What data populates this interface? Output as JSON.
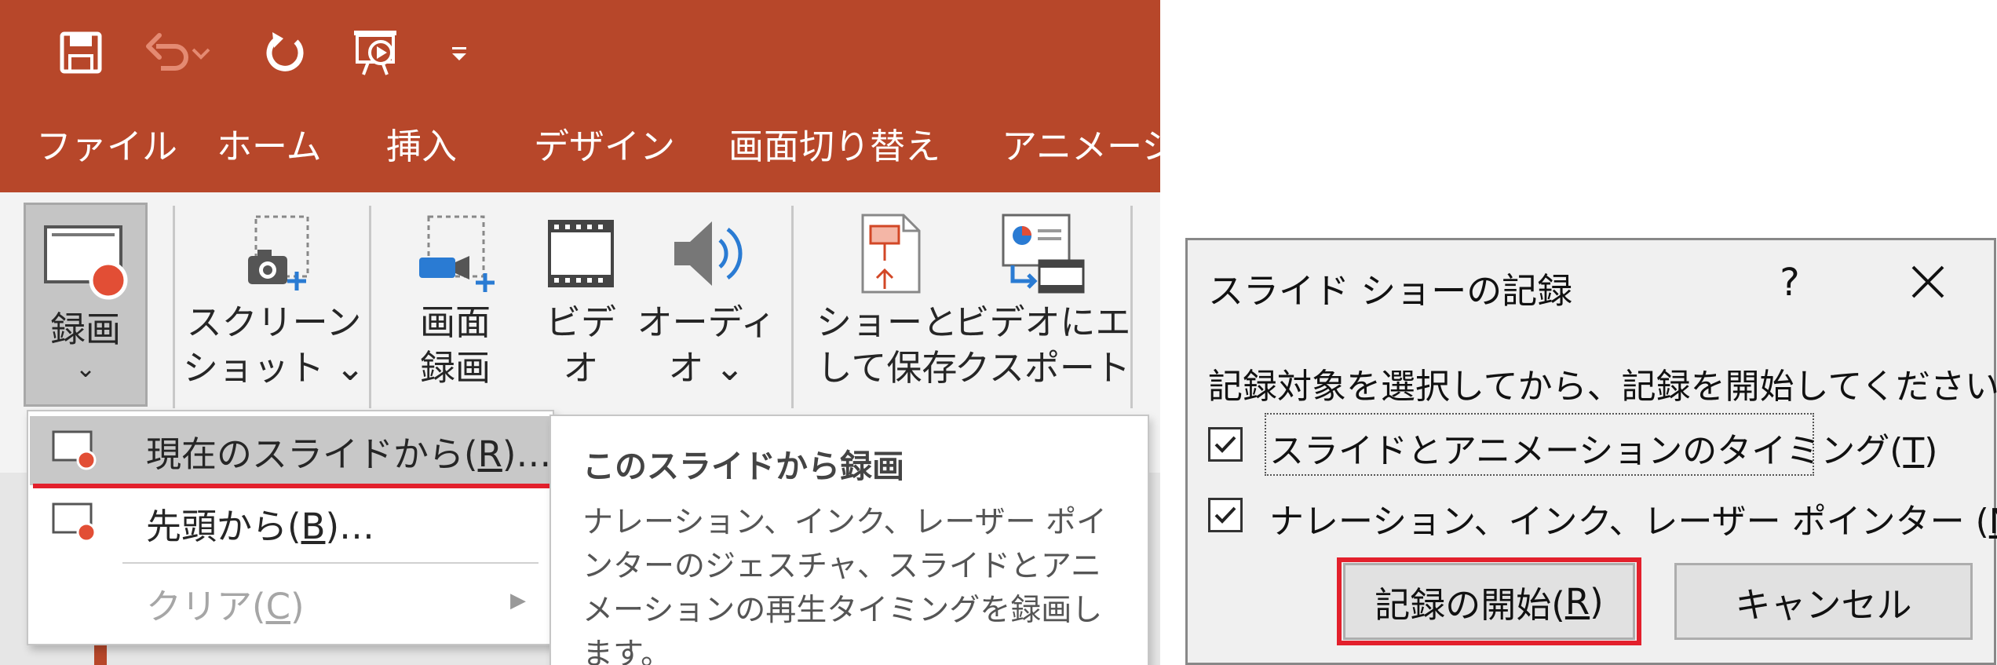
{
  "colors": {
    "title_bar": "#b7472a",
    "ribbon_bg": "#f3f3f3",
    "record_dot": "#e24e35",
    "highlight_red": "#e3202c",
    "dialog_bg": "#f0f0f0"
  },
  "qat": {
    "icons": [
      "save-icon",
      "undo-icon",
      "undo-dropdown-icon",
      "redo-icon",
      "slideshow-from-start-icon",
      "customize-qat-icon"
    ]
  },
  "menu_tabs": [
    "ファイル",
    "ホーム",
    "挿入",
    "デザイン",
    "画面切り替え",
    "アニメーショ"
  ],
  "ribbon": {
    "record": {
      "label": "録画",
      "chevron": "⌄",
      "icon": "record-slide-icon"
    },
    "screenshot": {
      "line1": "スクリーン",
      "line2": "ショット ⌄",
      "icon": "screenshot-icon"
    },
    "screen_recording": {
      "line1": "画面",
      "line2": "録画",
      "icon": "screen-recording-icon"
    },
    "video": {
      "line1": "ビデ",
      "line2": "オ",
      "icon": "video-film-icon"
    },
    "audio": {
      "line1": "オーディ",
      "line2": "オ ⌄",
      "icon": "speaker-icon"
    },
    "save_as_show": {
      "line1": "ショーと",
      "line2": "して保存",
      "icon": "save-as-show-icon"
    },
    "export_video": {
      "line1": "ビデオにエ",
      "line2": "クスポート",
      "icon": "export-video-icon"
    }
  },
  "dropdown": {
    "items": [
      {
        "pre": "現在のスライドから(",
        "key": "R",
        "post": ")…",
        "enabled": true
      },
      {
        "pre": "先頭から(",
        "key": "B",
        "post": ")…",
        "enabled": true
      },
      {
        "pre": "クリア(",
        "key": "C",
        "post": ")",
        "enabled": false
      }
    ],
    "submenu_arrow": "▶"
  },
  "tooltip": {
    "title": "このスライドから録画",
    "body": "ナレーション、インク、レーザー ポインターのジェスチャ、スライドとアニメーションの再生タイミングを録画します。"
  },
  "dialog": {
    "title": "スライド ショーの記録",
    "help": "?",
    "instruction": "記録対象を選択してから、記録を開始してください。",
    "options": [
      {
        "pre": "スライドとアニメーションのタイミング(",
        "key": "T",
        "post": ")",
        "checked": true
      },
      {
        "pre": "ナレーション、インク、レーザー ポインター (",
        "key": "N",
        "post": ")",
        "checked": true
      }
    ],
    "start_button": {
      "pre": "記録の開始(",
      "key": "R",
      "post": ")"
    },
    "cancel_button": "キャンセル"
  }
}
